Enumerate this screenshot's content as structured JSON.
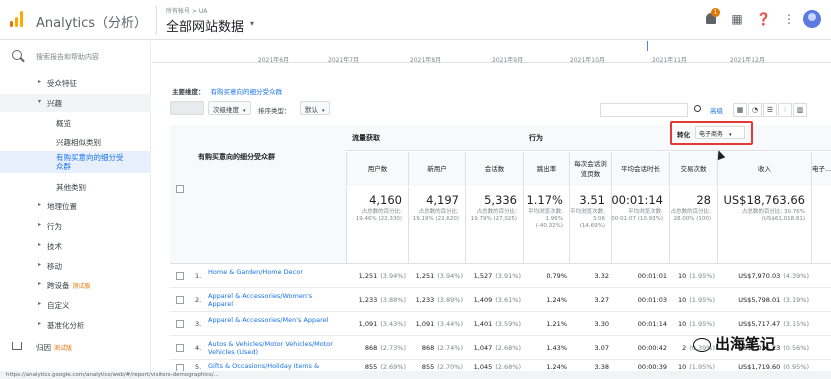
{
  "app": {
    "title": "Analytics（分析）"
  },
  "header": {
    "account_path": "所有帐号 > UA",
    "view_name": "全部网站数据",
    "notification_count": "1"
  },
  "sidebar": {
    "search_placeholder": "搜索报告和帮助内容",
    "items": [
      {
        "label": "受众特征",
        "arrow": "▸"
      },
      {
        "label": "兴趣",
        "arrow": "▾"
      },
      {
        "label": "概览",
        "arrow": ""
      },
      {
        "label": "兴趣相似类别",
        "arrow": ""
      },
      {
        "label": "有购买意向的细分受众群",
        "arrow": ""
      },
      {
        "label": "其他类别",
        "arrow": ""
      },
      {
        "label": "地理位置",
        "arrow": "▸"
      },
      {
        "label": "行为",
        "arrow": "▸"
      },
      {
        "label": "技术",
        "arrow": "▸"
      },
      {
        "label": "移动",
        "arrow": "▸"
      },
      {
        "label": "跨设备",
        "arrow": "▸",
        "badge": "测试版"
      },
      {
        "label": "自定义",
        "arrow": "▸"
      },
      {
        "label": "基准化分析",
        "arrow": "▸"
      }
    ],
    "bottom": {
      "label": "归因",
      "badge": "测试版"
    }
  },
  "timeline": {
    "labels": [
      "2021年6月",
      "2021年7月",
      "2021年8月",
      "2021年9月",
      "2021年10月",
      "2021年11月",
      "2021年12月"
    ]
  },
  "report": {
    "primary_dimension_label": "主要维度：",
    "primary_dimension_value": "有购买意向的细分受众群",
    "toolbar": {
      "secondary_dim": "次级维度",
      "sort_type_label": "排序类型：",
      "sort_default": "默认",
      "advanced": "高级"
    },
    "dimension_header": "有购买意向的细分受众群",
    "groups": {
      "acquisition": "流量获取",
      "behavior": "行为",
      "conversion": "转化"
    },
    "conversion_select": "电子商务",
    "columns": [
      "用户数",
      "新用户",
      "会话数",
      "跳出率",
      "每次会话浏览页数",
      "平均会话时长",
      "交易次数",
      "收入",
      "电子..."
    ],
    "totals": [
      {
        "big": "4,160",
        "small": "占总数的百分比: 19.46% (22,330)"
      },
      {
        "big": "4,197",
        "small": "占总数的百分比: 19.19% (22,620)"
      },
      {
        "big": "5,336",
        "small": "占总数的百分比: 19.79% (27,025)"
      },
      {
        "big": "1.17%",
        "small": "平均浏览次数: 1.96% (-40.32%)"
      },
      {
        "big": "3.51",
        "small": "平均浏览次数: 3.06 (14.69%)"
      },
      {
        "big": "00:01:14",
        "small": "平均浏览次数: 00:01:07 (10.93%)"
      },
      {
        "big": "28",
        "small": "占总数的百分比: 28.00% (100)"
      },
      {
        "big": "US$18,763.66",
        "small": "占总数的百分比: 30.76% (US$61,018.81)"
      }
    ],
    "rows": [
      {
        "idx": "1.",
        "name": "Home & Garden/Home Decor",
        "cells": [
          [
            "1,251",
            "(3.94%)"
          ],
          [
            "1,251",
            "(3.94%)"
          ],
          [
            "1,527",
            "(3.91%)"
          ],
          [
            "0.79%",
            ""
          ],
          [
            "3.32",
            ""
          ],
          [
            "00:01:01",
            ""
          ],
          [
            "10",
            "(1.95%)"
          ],
          [
            "US$7,970.03",
            "(4.39%)"
          ]
        ]
      },
      {
        "idx": "2.",
        "name": "Apparel & Accessories/Women's Apparel",
        "cells": [
          [
            "1,233",
            "(3.88%)"
          ],
          [
            "1,233",
            "(3.89%)"
          ],
          [
            "1,409",
            "(3.61%)"
          ],
          [
            "1.24%",
            ""
          ],
          [
            "3.27",
            ""
          ],
          [
            "00:01:03",
            ""
          ],
          [
            "10",
            "(1.95%)"
          ],
          [
            "US$5,798.01",
            "(3.19%)"
          ]
        ]
      },
      {
        "idx": "3.",
        "name": "Apparel & Accessories/Men's Apparel",
        "cells": [
          [
            "1,091",
            "(3.43%)"
          ],
          [
            "1,091",
            "(3.44%)"
          ],
          [
            "1,401",
            "(3.59%)"
          ],
          [
            "1.21%",
            ""
          ],
          [
            "3.30",
            ""
          ],
          [
            "00:01:14",
            ""
          ],
          [
            "10",
            "(1.95%)"
          ],
          [
            "US$5,717.47",
            "(3.15%)"
          ]
        ]
      },
      {
        "idx": "4.",
        "name": "Autos & Vehicles/Motor Vehicles/Motor Vehicles (Used)",
        "cells": [
          [
            "868",
            "(2.73%)"
          ],
          [
            "868",
            "(2.74%)"
          ],
          [
            "1,047",
            "(2.68%)"
          ],
          [
            "1.43%",
            ""
          ],
          [
            "3.07",
            ""
          ],
          [
            "00:00:42",
            ""
          ],
          [
            "2",
            "(0.39%)"
          ],
          [
            "US$1,025.23",
            "(0.56%)"
          ]
        ]
      },
      {
        "idx": "5.",
        "name": "Gifts & Occasions/Holiday Items & Decorations",
        "cells": [
          [
            "855",
            "(2.69%)"
          ],
          [
            "855",
            "(2.70%)"
          ],
          [
            "1,045",
            "(2.68%)"
          ],
          [
            "1.24%",
            ""
          ],
          [
            "3.38",
            ""
          ],
          [
            "00:00:39",
            ""
          ],
          [
            "10",
            "(1.95%)"
          ],
          [
            "US$1,719.60",
            "(0.95%)"
          ]
        ]
      }
    ]
  },
  "watermark": "出海笔记",
  "status_url": "https://analytics.google.com/analytics/web/#/report/visitors-demographics/..."
}
